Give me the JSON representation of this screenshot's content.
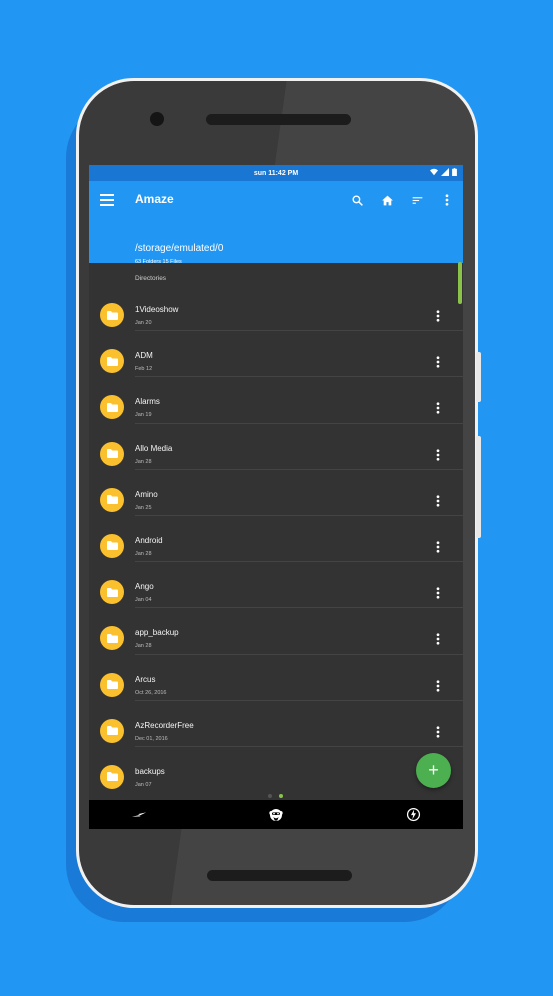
{
  "status_bar": {
    "time": "sun 11:42 PM"
  },
  "app_bar": {
    "title": "Amaze",
    "path": "/storage/emulated/0",
    "summary": "63 Folders 15 Files"
  },
  "section_label": "Directories",
  "folders": [
    {
      "name": "1Videoshow",
      "date": "Jan 20"
    },
    {
      "name": "ADM",
      "date": "Feb 12"
    },
    {
      "name": "Alarms",
      "date": "Jan 19"
    },
    {
      "name": "Allo Media",
      "date": "Jan 28"
    },
    {
      "name": "Amino",
      "date": "Jan 25"
    },
    {
      "name": "Android",
      "date": "Jan 28"
    },
    {
      "name": "Ango",
      "date": "Jan 04"
    },
    {
      "name": "app_backup",
      "date": "Jan 28"
    },
    {
      "name": "Arcus",
      "date": "Oct 26, 2016"
    },
    {
      "name": "AzRecorderFree",
      "date": "Dec 01, 2016"
    },
    {
      "name": "backups",
      "date": "Jan 07"
    }
  ],
  "fab_label": "+",
  "colors": {
    "background": "#2196F3",
    "app_bar": "#2196F3",
    "status_bar": "#1976D2",
    "folder_icon": "#FBC02D",
    "fab": "#4CAF50",
    "accent": "#8BC34A",
    "list_background": "#333333"
  },
  "icons": {
    "menu": "menu-icon",
    "search": "search-icon",
    "home": "home-icon",
    "sort": "sort-icon",
    "more": "more-vert-icon",
    "folder": "folder-icon",
    "fab": "add-icon",
    "bottom_left": "lightning-streak-icon",
    "bottom_center": "monkey-logo-icon",
    "bottom_right": "flash-circle-icon"
  }
}
